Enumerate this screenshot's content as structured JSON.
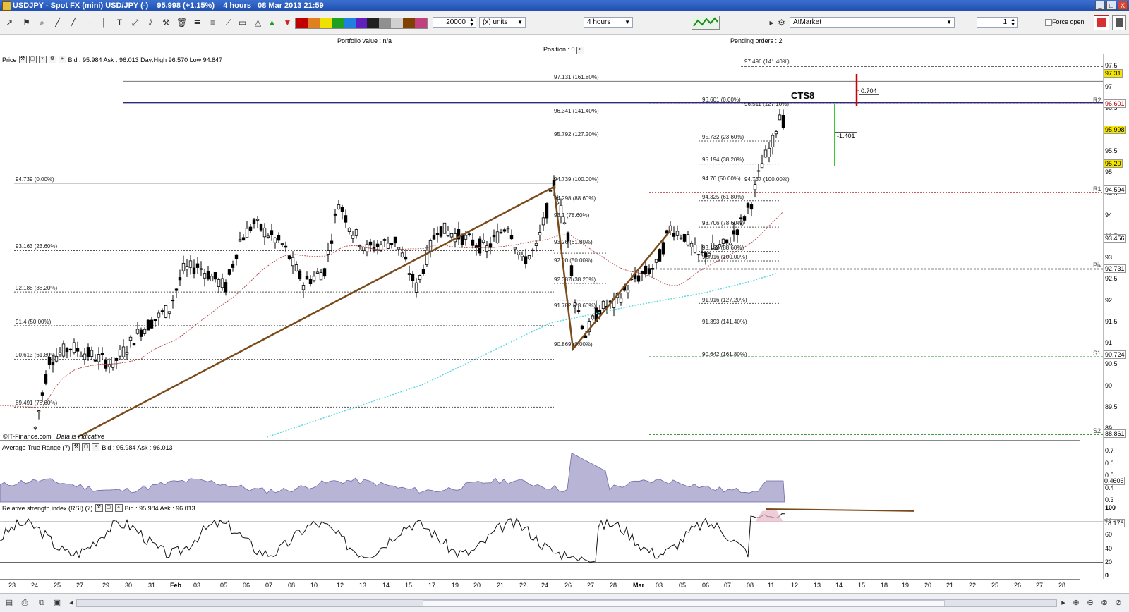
{
  "window": {
    "title": "USDJPY - Spot FX (mini) USD/JPY (-)    95.998 (+1.15%)    4 hours   08 Mar 2013 21:59",
    "buttons": [
      "_",
      "□",
      "X"
    ]
  },
  "toolbar": {
    "quantity": "20000",
    "units": "(x) units",
    "timeframe": "4 hours",
    "order_type": "AtMarket",
    "lots": "1",
    "force_open": "Force open"
  },
  "info": {
    "portfolio": "Portfolio value : n/a",
    "position": "Position : 0",
    "pending": "Pending orders : 2"
  },
  "price_panel": {
    "name": "Price",
    "quote": "Bid : 95.984  Ask : 96.013  Day:High 96.570  Low 94.847",
    "watermark": "©IT-Finance.com",
    "indicative": "Data is indicative",
    "cts_label": "CTS8",
    "box_a": "0.704",
    "box_b": "-1.401",
    "pivot_labels": [
      "R2",
      "R1",
      "Piv",
      "S1",
      "S2"
    ],
    "fib_labels": [
      "97.496 (141.40%)",
      "97.131 (161.80%)",
      "96.601 (0.00%)",
      "96.511 (127.10%)",
      "96.341 (141.40%)",
      "95.792 (127.20%)",
      "95.732 (23.60%)",
      "95.194 (38.20%)",
      "94.739 (100.00%)",
      "94.739 (0.00%)",
      "94.76 (50.00%)",
      "94.737 (100.00%)",
      "94.298 (88.60%)",
      "94.325 (61.80%)",
      "93.1 (78.60%)",
      "93.706 (78.60%)",
      "93.163 (23.60%)",
      "93.26 (61.80%)",
      "93.138 (88.60%)",
      "92.916 (100.00%)",
      "92.188 (38.20%)",
      "92.387 (38.20%)",
      "92.00 (50.00%)",
      "91.916 (127.20%)",
      "91.4 (50.00%)",
      "91.782 (23.60%)",
      "91.393 (141.40%)",
      "90.613 (61.80%)",
      "90.869 (0.00%)",
      "90.642 (161.80%)",
      "89.491 (78.60%)"
    ],
    "axis_ticks": [
      "97.5",
      "97",
      "96.5",
      "96",
      "95.5",
      "95",
      "94.5",
      "94",
      "93.5",
      "93",
      "92.5",
      "92",
      "91.5",
      "91",
      "90.5",
      "90",
      "89.5",
      "89"
    ],
    "price_tags": [
      "97.31",
      "96.601",
      "95.998",
      "95.20",
      "94.594",
      "93.456",
      "92.731",
      "90.724",
      "88.861"
    ]
  },
  "atr_panel": {
    "name": "Average True Range (7)",
    "quote": "Bid : 95.984  Ask : 96.013",
    "axis_ticks": [
      "0.7",
      "0.6",
      "0.5",
      "0.4",
      "0.3"
    ],
    "value_tag": "0.4606"
  },
  "rsi_panel": {
    "name": "Relative strength index (RSI) (7)",
    "quote": "Bid : 95.984  Ask : 96.013",
    "axis_ticks": [
      "100",
      "80",
      "60",
      "40",
      "20",
      "0"
    ],
    "value_tag": "78.176"
  },
  "dates": [
    "23",
    "24",
    "25",
    "27",
    "29",
    "30",
    "31",
    "Feb",
    "03",
    "05",
    "06",
    "07",
    "08",
    "10",
    "12",
    "13",
    "14",
    "15",
    "17",
    "19",
    "20",
    "21",
    "22",
    "24",
    "26",
    "27",
    "28",
    "Mar",
    "03",
    "05",
    "06",
    "07",
    "08",
    "11",
    "12",
    "13",
    "14",
    "15",
    "18",
    "19",
    "20",
    "21",
    "22",
    "25",
    "26",
    "27",
    "28"
  ],
  "colors": {
    "title_blue": "#1f4fb0",
    "trend": "#7a4a1a",
    "ma_red": "#b85050",
    "ma_cyan": "#5dd6e0",
    "atr_fill": "#b7b4d6",
    "yellow_tag": "#f5e600",
    "red_tag": "#e06060"
  }
}
